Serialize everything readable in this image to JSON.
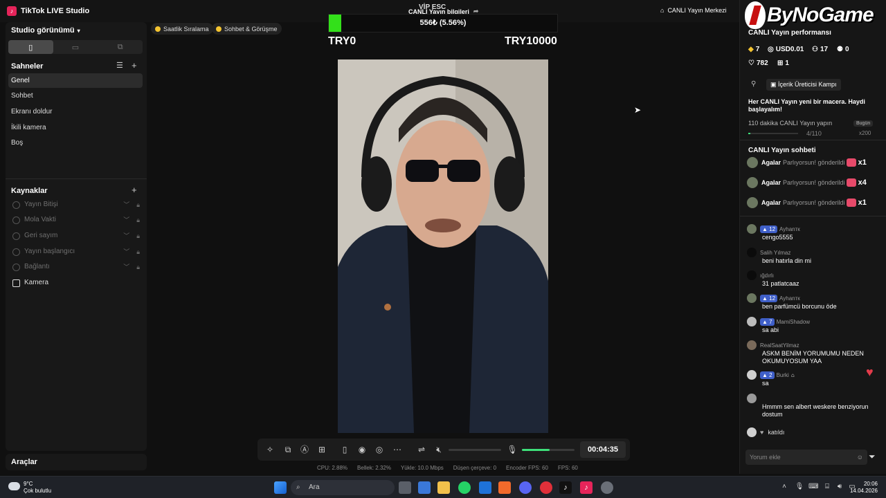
{
  "app": {
    "title": "TikTok LIVE Studio",
    "logo_glyph": "♪"
  },
  "header": {
    "live_info_label": "CANLI Yayın bilgileri",
    "overlay_text": "VİP ESC",
    "center_link": "CANLI Yayın Merkezi"
  },
  "sidebar": {
    "studio_view_label": "Studio görünümü",
    "scenes_title": "Sahneler",
    "scenes": [
      "Genel",
      "Sohbet",
      "Ekranı doldur",
      "İkili kamera",
      "Boş"
    ],
    "active_scene_index": 0,
    "sources_title": "Kaynaklar",
    "sources": [
      "Yayın Bitişi",
      "Mola Vakti",
      "Geri sayım",
      "Yayın başlangıcı",
      "Bağlantı"
    ],
    "camera_source": "Kamera",
    "tools_title": "Araçlar"
  },
  "chips": [
    "Saatlik Sıralama",
    "Sohbet & Görüşme"
  ],
  "goal": {
    "text": "556₺ (5.56%)",
    "progress_percent": 5.56,
    "min_label": "TRY0",
    "max_label": "TRY10000",
    "fill_color": "#33e01a"
  },
  "controls": {
    "timer": "00:04:35",
    "mic_level_percent": 52,
    "volume_level_percent": 0,
    "accent_color": "#3ee07a"
  },
  "status_bar": {
    "cpu": "CPU: 2.88%",
    "memory": "Bellek: 2.32%",
    "upload": "Yükle: 10.0 Mbps",
    "dropped": "Düşen çerçeve: 0",
    "encoder_fps": "Encoder FPS: 60",
    "fps": "FPS: 60"
  },
  "right_panel": {
    "performance_title": "CANLI Yayın performansı",
    "stats": {
      "diamonds": "7",
      "usd": "USD0.01",
      "viewers": "17",
      "new_followers": "0",
      "likes": "782",
      "gifts": "1"
    },
    "camp_button": "İçerik Üreticisi Kampı",
    "promo_text": "Her CANLI Yayın yeni bir macera. Haydi başlayalım!",
    "task_text": "110 dakika CANLI Yayın yapın",
    "task_badge": "Bugün",
    "task_progress": "4/110",
    "task_reward": "x200",
    "chat_title": "CANLI Yayın sohbeti",
    "gifts": [
      {
        "user": "Agalar",
        "text": "Parlıyorsun! gönderildi",
        "count": "x1"
      },
      {
        "user": "Agalar",
        "text": "Parlıyorsun! gönderildi",
        "count": "x4"
      },
      {
        "user": "Agalar",
        "text": "Parlıyorsun! gönderildi",
        "count": "x1"
      }
    ],
    "messages": [
      {
        "badge": "12",
        "user": "Ayhanтк",
        "text": "cengo5555"
      },
      {
        "badge": "",
        "user": "Salih Yılmaz",
        "text": "beni hatırla din mi"
      },
      {
        "badge": "",
        "user": "ığdırlı",
        "text": "31 patlatcaaz"
      },
      {
        "badge": "12",
        "user": "Ayhanтк",
        "text": "ben parfümcü borcunu öde"
      },
      {
        "badge": "7",
        "user": "MamiShadow",
        "text": "sa abi"
      },
      {
        "badge": "",
        "user": "RealSaatYilmaz",
        "text": "ASKM BENİM YORUMUMU NEDEN OKUMUYOSUM YAA"
      },
      {
        "badge": "2",
        "user": "Burki",
        "text": "sa"
      },
      {
        "badge": "",
        "user": "",
        "text": "Hmmm sen albert weskere benziyorun dostum"
      }
    ],
    "join_text": "katıldı",
    "comment_placeholder": "Yorum ekle"
  },
  "watermark": {
    "text": "ByNoGame"
  },
  "taskbar": {
    "weather_temp": "9°C",
    "weather_desc": "Çok bulutlu",
    "search_label": "Ara",
    "time": "20:06",
    "date": "14.04.2026"
  }
}
